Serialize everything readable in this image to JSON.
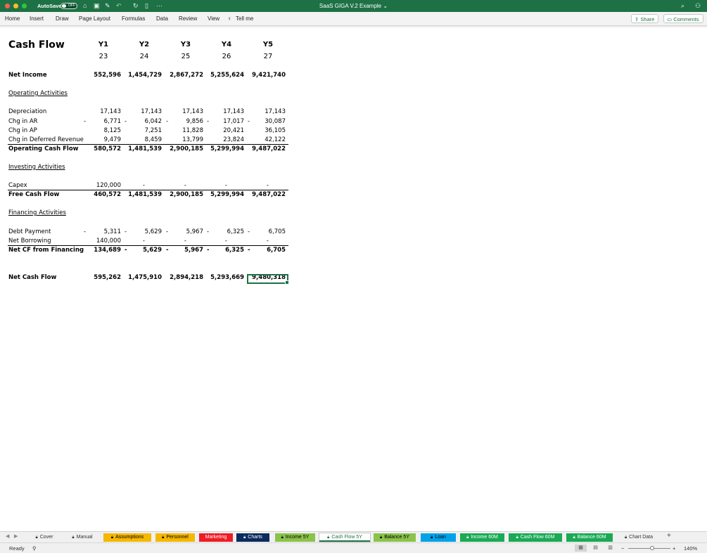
{
  "window": {
    "autosave_label": "AutoSave",
    "autosave_state": "OFF",
    "title": "SaaS GIGA V.2 Example",
    "title_chevron": "⌄"
  },
  "ribbon": {
    "tabs": [
      "Home",
      "Insert",
      "Draw",
      "Page Layout",
      "Formulas",
      "Data",
      "Review",
      "View"
    ],
    "tell_me": "Tell me",
    "share": "Share",
    "comments": "Comments"
  },
  "sheet": {
    "title": "Cash Flow",
    "years": [
      {
        "label": "Y1",
        "num": "23"
      },
      {
        "label": "Y2",
        "num": "24"
      },
      {
        "label": "Y3",
        "num": "25"
      },
      {
        "label": "Y4",
        "num": "26"
      },
      {
        "label": "Y5",
        "num": "27"
      }
    ],
    "rows": [
      {
        "label": "Net Income",
        "bold": true,
        "values": [
          "552,596",
          "1,454,729",
          "2,867,272",
          "5,255,624",
          "9,421,740"
        ]
      },
      {
        "label": "Operating Activities",
        "section": true
      },
      {
        "label": "Depreciation",
        "values": [
          "17,143",
          "17,143",
          "17,143",
          "17,143",
          "17,143"
        ]
      },
      {
        "label": "Chg in AR",
        "values": [
          "6,771",
          "6,042",
          "9,856",
          "17,017",
          "30,087"
        ],
        "neg": [
          true,
          true,
          true,
          true,
          true
        ]
      },
      {
        "label": "Chg in AP",
        "values": [
          "8,125",
          "7,251",
          "11,828",
          "20,421",
          "36,105"
        ]
      },
      {
        "label": "Chg in Deferred Revenue",
        "values": [
          "9,479",
          "8,459",
          "13,799",
          "23,824",
          "42,122"
        ]
      },
      {
        "label": "Operating Cash Flow",
        "bold": true,
        "values": [
          "580,572",
          "1,481,539",
          "2,900,185",
          "5,299,994",
          "9,487,022"
        ]
      },
      {
        "label": "Investing Activities",
        "section": true
      },
      {
        "label": "Capex",
        "values": [
          "120,000",
          "-",
          "-",
          "-",
          "-"
        ]
      },
      {
        "label": "Free Cash Flow",
        "bold": true,
        "values": [
          "460,572",
          "1,481,539",
          "2,900,185",
          "5,299,994",
          "9,487,022"
        ]
      },
      {
        "label": "Financing Activities",
        "section": true
      },
      {
        "label": "Debt Payment",
        "values": [
          "5,311",
          "5,629",
          "5,967",
          "6,325",
          "6,705"
        ],
        "neg": [
          true,
          true,
          true,
          true,
          true
        ]
      },
      {
        "label": "Net Borrowing",
        "values": [
          "140,000",
          "-",
          "-",
          "-",
          "-"
        ]
      },
      {
        "label": "Net CF from Financing",
        "bold": true,
        "values": [
          "134,689",
          "5,629",
          "5,967",
          "6,325",
          "6,705"
        ],
        "neg": [
          false,
          true,
          true,
          true,
          true
        ]
      },
      {
        "label": "Net Cash Flow",
        "bold": true,
        "values": [
          "595,262",
          "1,475,910",
          "2,894,218",
          "5,293,669",
          "9,480,318"
        ]
      }
    ],
    "neg_sign": "-"
  },
  "tabs": [
    {
      "label": "Cover",
      "bg": "#f0f0f0",
      "fg": "#333333",
      "lock": true
    },
    {
      "label": "Manual",
      "bg": "#f0f0f0",
      "fg": "#333333",
      "lock": true
    },
    {
      "label": "Assumptions",
      "bg": "#f5b800",
      "fg": "#000000",
      "lock": true
    },
    {
      "label": "Personnel",
      "bg": "#f5b800",
      "fg": "#000000",
      "lock": true
    },
    {
      "label": "Marketing",
      "bg": "#ee1c25",
      "fg": "#ffffff",
      "lock": false
    },
    {
      "label": "Charts",
      "bg": "#0b2a5e",
      "fg": "#ffffff",
      "lock": true
    },
    {
      "label": "Income 5Y",
      "bg": "#8bc34a",
      "fg": "#000000",
      "lock": true
    },
    {
      "label": "Cash Flow 5Y",
      "bg": "#ffffff",
      "fg": "#1e7145",
      "lock": true,
      "active": true
    },
    {
      "label": "Balance 5Y",
      "bg": "#8bc34a",
      "fg": "#000000",
      "lock": true
    },
    {
      "label": "Loan",
      "bg": "#00a2e8",
      "fg": "#000000",
      "lock": true
    },
    {
      "label": "Income 60M",
      "bg": "#1aaa55",
      "fg": "#ffffff",
      "lock": true
    },
    {
      "label": "Cash Flow 60M",
      "bg": "#1aaa55",
      "fg": "#ffffff",
      "lock": true
    },
    {
      "label": "Balance 60M",
      "bg": "#1aaa55",
      "fg": "#ffffff",
      "lock": true
    },
    {
      "label": "Chart Data",
      "bg": "#f0f0f0",
      "fg": "#333333",
      "lock": true
    }
  ],
  "status": {
    "ready": "Ready",
    "zoom": "140%"
  },
  "colors": {
    "accent": "#1e7145"
  }
}
